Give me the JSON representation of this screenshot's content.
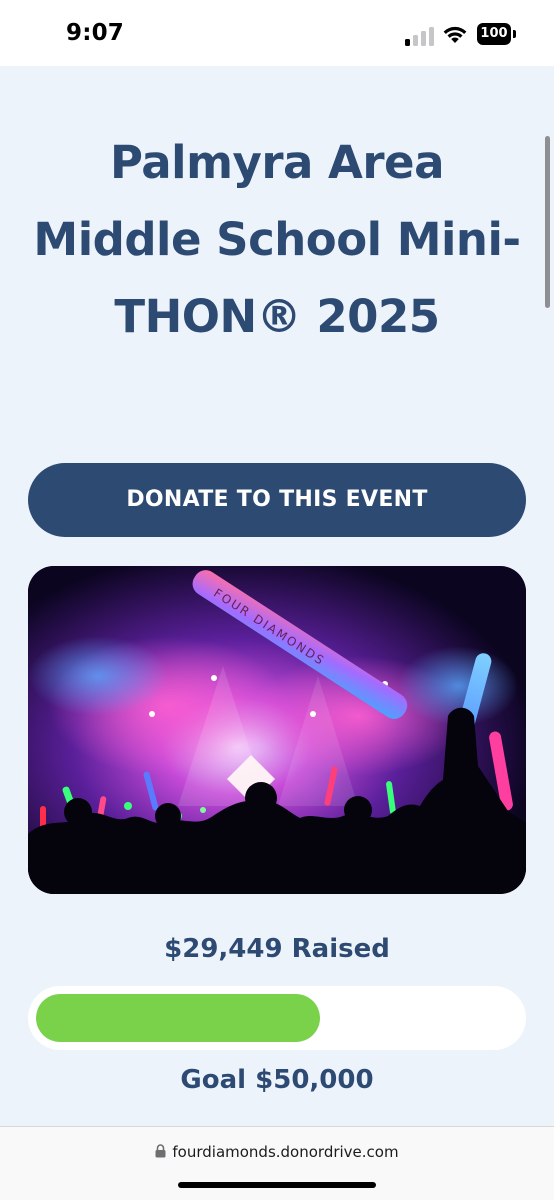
{
  "status_bar": {
    "time": "9:07",
    "battery": "100",
    "icons": [
      "signal-icon",
      "wifi-icon",
      "battery-icon"
    ]
  },
  "event": {
    "title": "Palmyra Area Middle School Mini-THON® 2025",
    "donate_label": "DONATE TO THIS EVENT",
    "photo_text": "FOUR DIAMONDS"
  },
  "fundraising": {
    "raised_label": "$29,449 Raised",
    "goal_label": "Goal $50,000",
    "raised_amount": 29449,
    "goal_amount": 50000,
    "progress_fraction": 0.589
  },
  "browser": {
    "url": "fourdiamonds.donordrive.com",
    "icons": [
      "lock-icon"
    ]
  },
  "colors": {
    "brand_navy": "#2d4a73",
    "progress_green": "#7ad24b",
    "page_background": "#edf3fb"
  }
}
